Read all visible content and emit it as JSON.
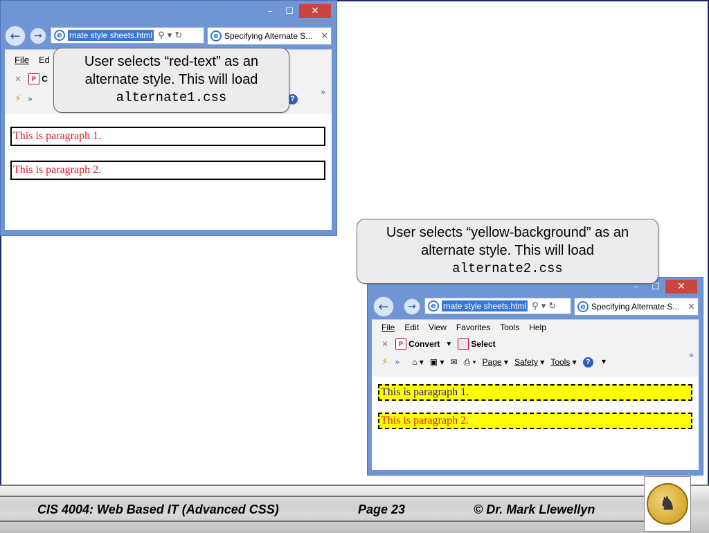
{
  "window1": {
    "url": "rnate style sheets.html",
    "tab_title": "Specifying Alternate S...",
    "menu_partial": [
      "File",
      "Ed"
    ],
    "cmd_partial": "C",
    "paragraphs": [
      "This is paragraph 1.",
      "This is paragraph 2."
    ]
  },
  "window2": {
    "url": "rnate style sheets.html",
    "tab_title": "Specifying Alternate S...",
    "menu": [
      "File",
      "Edit",
      "View",
      "Favorites",
      "Tools",
      "Help"
    ],
    "cmd": {
      "convert": "Convert",
      "select": "Select"
    },
    "fav_bar": {
      "page": "Page",
      "safety": "Safety",
      "tools": "Tools"
    },
    "paragraphs": [
      "This is paragraph 1.",
      "This is paragraph 2."
    ]
  },
  "callout1": {
    "line1": "User selects “red-text” as an",
    "line2": "alternate style.  This will load",
    "file": "alternate1.css"
  },
  "callout2": {
    "line1": "User selects “yellow-background” as an",
    "line2": "alternate style.  This will load",
    "file": "alternate2.css"
  },
  "footer": {
    "course": "CIS 4004: Web Based IT (Advanced CSS)",
    "page": "Page 23",
    "author": "© Dr. Mark Llewellyn"
  },
  "icons": {
    "back": "back-arrow-icon",
    "forward": "forward-arrow-icon",
    "ie": "ie-logo-icon",
    "help": "help-icon",
    "favorites": "favorites-star-icon"
  },
  "colors": {
    "window_frame": "#6f95d4",
    "close_button": "#c9463d",
    "red_text": "#e0191b",
    "yellow_bg": "#ffff00"
  }
}
